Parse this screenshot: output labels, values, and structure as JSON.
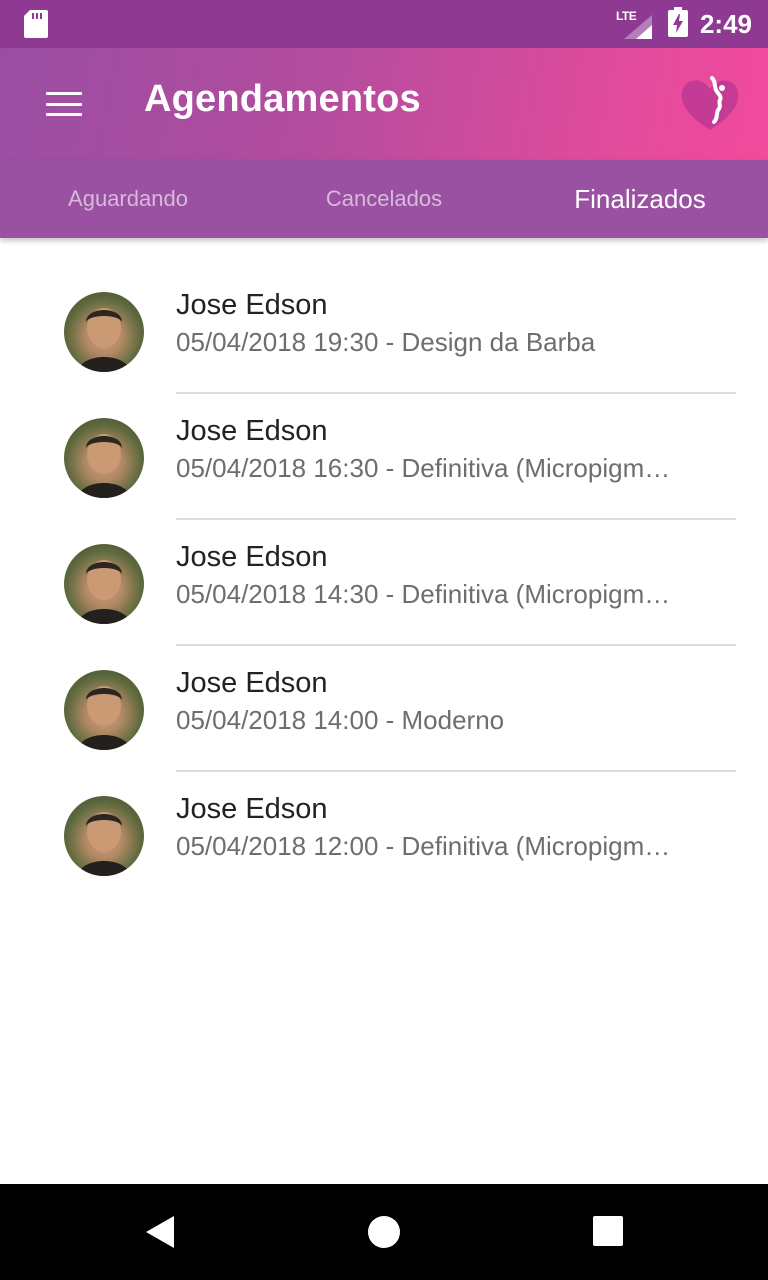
{
  "status_bar": {
    "network_label": "LTE",
    "time": "2:49",
    "icons": [
      "sd-card-icon",
      "lte-signal-icon",
      "battery-charging-icon"
    ]
  },
  "app_bar": {
    "title": "Agendamentos",
    "menu_icon": "hamburger-menu-icon",
    "logo_icon": "heart-face-logo-icon",
    "gradient_colors": [
      "#9a4ea3",
      "#f24a9c"
    ]
  },
  "tabs": [
    {
      "label": "Aguardando",
      "active": false
    },
    {
      "label": "Cancelados",
      "active": false
    },
    {
      "label": "Finalizados",
      "active": true
    }
  ],
  "appointments": [
    {
      "name": "Jose Edson",
      "detail": "05/04/2018 19:30 - Design da Barba"
    },
    {
      "name": "Jose Edson",
      "detail": "05/04/2018 16:30 - Definitiva (Micropigm…"
    },
    {
      "name": "Jose Edson",
      "detail": "05/04/2018 14:30 - Definitiva (Micropigm…"
    },
    {
      "name": "Jose Edson",
      "detail": "05/04/2018 14:00 - Moderno"
    },
    {
      "name": "Jose Edson",
      "detail": "05/04/2018 12:00 - Definitiva (Micropigm…"
    }
  ],
  "nav_bar": {
    "icons": [
      "back-triangle-icon",
      "home-circle-icon",
      "recents-square-icon"
    ]
  },
  "colors": {
    "status_bar": "#8e3a92",
    "tab_bar": "#9b51a2",
    "primary_text": "#222222",
    "secondary_text": "#6e6e6e"
  }
}
